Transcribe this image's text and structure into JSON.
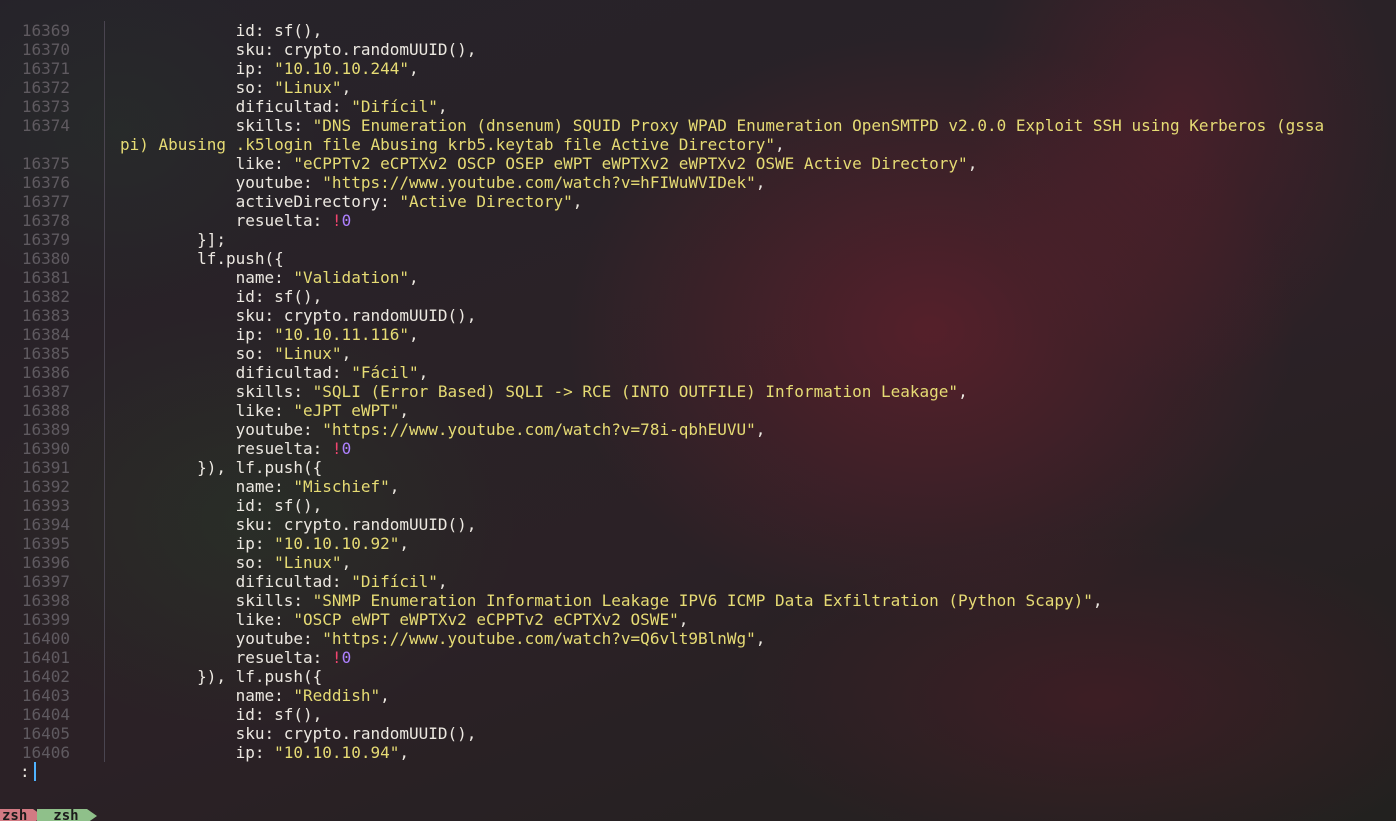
{
  "editor": {
    "lines": [
      {
        "n": "16369",
        "indent": "            ",
        "tokens": [
          {
            "t": "id: sf(),"
          }
        ]
      },
      {
        "n": "16370",
        "indent": "            ",
        "tokens": [
          {
            "t": "sku: crypto.randomUUID(),"
          }
        ]
      },
      {
        "n": "16371",
        "indent": "            ",
        "tokens": [
          {
            "t": "ip: "
          },
          {
            "t": "\"10.10.10.244\"",
            "c": "str"
          },
          {
            "t": ","
          }
        ]
      },
      {
        "n": "16372",
        "indent": "            ",
        "tokens": [
          {
            "t": "so: "
          },
          {
            "t": "\"Linux\"",
            "c": "str"
          },
          {
            "t": ","
          }
        ]
      },
      {
        "n": "16373",
        "indent": "            ",
        "tokens": [
          {
            "t": "dificultad: "
          },
          {
            "t": "\"Difícil\"",
            "c": "str"
          },
          {
            "t": ","
          }
        ]
      },
      {
        "n": "16374",
        "indent": "            ",
        "tokens": [
          {
            "t": "skills: "
          },
          {
            "t": "\"DNS Enumeration (dnsenum) SQUID Proxy WPAD Enumeration OpenSMTPD v2.0.0 Exploit SSH using Kerberos (gssa",
            "c": "str"
          }
        ]
      },
      {
        "n": "",
        "indent": "",
        "tokens": [
          {
            "t": "pi) Abusing .k5login file Abusing krb5.keytab file Active Directory\"",
            "c": "str"
          },
          {
            "t": ","
          }
        ]
      },
      {
        "n": "16375",
        "indent": "            ",
        "tokens": [
          {
            "t": "like: "
          },
          {
            "t": "\"eCPPTv2 eCPTXv2 OSCP OSEP eWPT eWPTXv2 eWPTXv2 OSWE Active Directory\"",
            "c": "str"
          },
          {
            "t": ","
          }
        ]
      },
      {
        "n": "16376",
        "indent": "            ",
        "tokens": [
          {
            "t": "youtube: "
          },
          {
            "t": "\"https://www.youtube.com/watch?v=hFIWuWVIDek\"",
            "c": "str"
          },
          {
            "t": ","
          }
        ]
      },
      {
        "n": "16377",
        "indent": "            ",
        "tokens": [
          {
            "t": "activeDirectory: "
          },
          {
            "t": "\"Active Directory\"",
            "c": "str"
          },
          {
            "t": ","
          }
        ]
      },
      {
        "n": "16378",
        "indent": "            ",
        "tokens": [
          {
            "t": "resuelta: "
          },
          {
            "t": "!",
            "c": "bang"
          },
          {
            "t": "0",
            "c": "num"
          }
        ]
      },
      {
        "n": "16379",
        "indent": "        ",
        "tokens": [
          {
            "t": "}];"
          }
        ]
      },
      {
        "n": "16380",
        "indent": "        ",
        "tokens": [
          {
            "t": "lf.push({"
          }
        ]
      },
      {
        "n": "16381",
        "indent": "            ",
        "tokens": [
          {
            "t": "name: "
          },
          {
            "t": "\"Validation\"",
            "c": "str"
          },
          {
            "t": ","
          }
        ]
      },
      {
        "n": "16382",
        "indent": "            ",
        "tokens": [
          {
            "t": "id: sf(),"
          }
        ]
      },
      {
        "n": "16383",
        "indent": "            ",
        "tokens": [
          {
            "t": "sku: crypto.randomUUID(),"
          }
        ]
      },
      {
        "n": "16384",
        "indent": "            ",
        "tokens": [
          {
            "t": "ip: "
          },
          {
            "t": "\"10.10.11.116\"",
            "c": "str"
          },
          {
            "t": ","
          }
        ]
      },
      {
        "n": "16385",
        "indent": "            ",
        "tokens": [
          {
            "t": "so: "
          },
          {
            "t": "\"Linux\"",
            "c": "str"
          },
          {
            "t": ","
          }
        ]
      },
      {
        "n": "16386",
        "indent": "            ",
        "tokens": [
          {
            "t": "dificultad: "
          },
          {
            "t": "\"Fácil\"",
            "c": "str"
          },
          {
            "t": ","
          }
        ]
      },
      {
        "n": "16387",
        "indent": "            ",
        "tokens": [
          {
            "t": "skills: "
          },
          {
            "t": "\"SQLI (Error Based) SQLI -> RCE (INTO OUTFILE) Information Leakage\"",
            "c": "str"
          },
          {
            "t": ","
          }
        ]
      },
      {
        "n": "16388",
        "indent": "            ",
        "tokens": [
          {
            "t": "like: "
          },
          {
            "t": "\"eJPT eWPT\"",
            "c": "str"
          },
          {
            "t": ","
          }
        ]
      },
      {
        "n": "16389",
        "indent": "            ",
        "tokens": [
          {
            "t": "youtube: "
          },
          {
            "t": "\"https://www.youtube.com/watch?v=78i-qbhEUVU\"",
            "c": "str"
          },
          {
            "t": ","
          }
        ]
      },
      {
        "n": "16390",
        "indent": "            ",
        "tokens": [
          {
            "t": "resuelta: "
          },
          {
            "t": "!",
            "c": "bang"
          },
          {
            "t": "0",
            "c": "num"
          }
        ]
      },
      {
        "n": "16391",
        "indent": "        ",
        "tokens": [
          {
            "t": "}), lf.push({"
          }
        ]
      },
      {
        "n": "16392",
        "indent": "            ",
        "tokens": [
          {
            "t": "name: "
          },
          {
            "t": "\"Mischief\"",
            "c": "str"
          },
          {
            "t": ","
          }
        ]
      },
      {
        "n": "16393",
        "indent": "            ",
        "tokens": [
          {
            "t": "id: sf(),"
          }
        ]
      },
      {
        "n": "16394",
        "indent": "            ",
        "tokens": [
          {
            "t": "sku: crypto.randomUUID(),"
          }
        ]
      },
      {
        "n": "16395",
        "indent": "            ",
        "tokens": [
          {
            "t": "ip: "
          },
          {
            "t": "\"10.10.10.92\"",
            "c": "str"
          },
          {
            "t": ","
          }
        ]
      },
      {
        "n": "16396",
        "indent": "            ",
        "tokens": [
          {
            "t": "so: "
          },
          {
            "t": "\"Linux\"",
            "c": "str"
          },
          {
            "t": ","
          }
        ]
      },
      {
        "n": "16397",
        "indent": "            ",
        "tokens": [
          {
            "t": "dificultad: "
          },
          {
            "t": "\"Difícil\"",
            "c": "str"
          },
          {
            "t": ","
          }
        ]
      },
      {
        "n": "16398",
        "indent": "            ",
        "tokens": [
          {
            "t": "skills: "
          },
          {
            "t": "\"SNMP Enumeration Information Leakage IPV6 ICMP Data Exfiltration (Python Scapy)\"",
            "c": "str"
          },
          {
            "t": ","
          }
        ]
      },
      {
        "n": "16399",
        "indent": "            ",
        "tokens": [
          {
            "t": "like: "
          },
          {
            "t": "\"OSCP eWPT eWPTXv2 eCPPTv2 eCPTXv2 OSWE\"",
            "c": "str"
          },
          {
            "t": ","
          }
        ]
      },
      {
        "n": "16400",
        "indent": "            ",
        "tokens": [
          {
            "t": "youtube: "
          },
          {
            "t": "\"https://www.youtube.com/watch?v=Q6vlt9BlnWg\"",
            "c": "str"
          },
          {
            "t": ","
          }
        ]
      },
      {
        "n": "16401",
        "indent": "            ",
        "tokens": [
          {
            "t": "resuelta: "
          },
          {
            "t": "!",
            "c": "bang"
          },
          {
            "t": "0",
            "c": "num"
          }
        ]
      },
      {
        "n": "16402",
        "indent": "        ",
        "tokens": [
          {
            "t": "}), lf.push({"
          }
        ]
      },
      {
        "n": "16403",
        "indent": "            ",
        "tokens": [
          {
            "t": "name: "
          },
          {
            "t": "\"Reddish\"",
            "c": "str"
          },
          {
            "t": ","
          }
        ]
      },
      {
        "n": "16404",
        "indent": "            ",
        "tokens": [
          {
            "t": "id: sf(),"
          }
        ]
      },
      {
        "n": "16405",
        "indent": "            ",
        "tokens": [
          {
            "t": "sku: crypto.randomUUID(),"
          }
        ]
      },
      {
        "n": "16406",
        "indent": "            ",
        "tokens": [
          {
            "t": "ip: "
          },
          {
            "t": "\"10.10.10.94\"",
            "c": "str"
          },
          {
            "t": ","
          }
        ]
      }
    ]
  },
  "pager": {
    "prompt": ":"
  },
  "statusbar": {
    "segment1": "zsh",
    "segment2": "zsh"
  },
  "colors": {
    "string": "#e6db74",
    "bang": "#f0446e",
    "number": "#ae81ff",
    "line_number": "#5f5a60",
    "text": "#ece8e1",
    "cursor": "#4fb3ff",
    "status_segment1": "#d27a83",
    "status_segment2": "#8fc08a"
  }
}
